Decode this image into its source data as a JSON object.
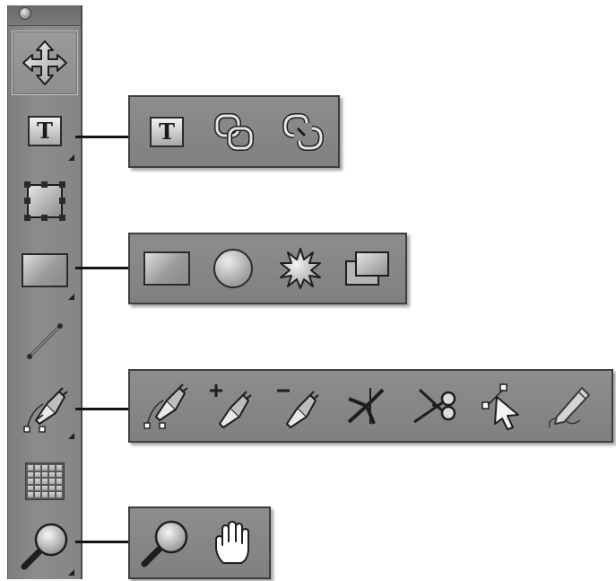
{
  "toolbar": {
    "tools": [
      {
        "name": "move-tool",
        "icon": "move-arrows-icon",
        "selected": true,
        "has_flyout": false
      },
      {
        "name": "text-tool",
        "icon": "text-icon",
        "label": "T",
        "selected": false,
        "has_flyout": true
      },
      {
        "name": "frame-tool",
        "icon": "frame-icon",
        "selected": false,
        "has_flyout": false
      },
      {
        "name": "rectangle-tool",
        "icon": "rectangle-icon",
        "selected": false,
        "has_flyout": true
      },
      {
        "name": "line-tool",
        "icon": "line-icon",
        "selected": false,
        "has_flyout": false
      },
      {
        "name": "pen-tool",
        "icon": "pen-icon",
        "selected": false,
        "has_flyout": true
      },
      {
        "name": "table-tool",
        "icon": "grid-icon",
        "selected": false,
        "has_flyout": false
      },
      {
        "name": "zoom-tool",
        "icon": "magnifier-icon",
        "selected": false,
        "has_flyout": true
      }
    ]
  },
  "flyouts": {
    "text": {
      "items": [
        {
          "name": "text-tool",
          "icon": "text-icon",
          "label": "T"
        },
        {
          "name": "link-text-tool",
          "icon": "link-icon"
        },
        {
          "name": "unlink-text-tool",
          "icon": "unlink-icon"
        }
      ]
    },
    "shapes": {
      "items": [
        {
          "name": "rectangle-tool",
          "icon": "rectangle-icon"
        },
        {
          "name": "ellipse-tool",
          "icon": "ellipse-icon"
        },
        {
          "name": "star-tool",
          "icon": "starburst-icon"
        },
        {
          "name": "shadow-rectangle-tool",
          "icon": "stacked-rectangles-icon"
        }
      ]
    },
    "pen": {
      "items": [
        {
          "name": "pen-tool",
          "icon": "pen-icon"
        },
        {
          "name": "add-anchor-tool",
          "icon": "pen-plus-icon",
          "sign": "+"
        },
        {
          "name": "delete-anchor-tool",
          "icon": "pen-minus-icon",
          "sign": "−"
        },
        {
          "name": "convert-anchor-tool",
          "icon": "convert-point-icon"
        },
        {
          "name": "scissors-tool",
          "icon": "scissors-icon"
        },
        {
          "name": "direct-select-tool",
          "icon": "direct-select-icon"
        },
        {
          "name": "pencil-tool",
          "icon": "pencil-icon"
        }
      ]
    },
    "zoom": {
      "items": [
        {
          "name": "zoom-tool",
          "icon": "magnifier-icon"
        },
        {
          "name": "hand-tool",
          "icon": "hand-icon"
        }
      ]
    }
  },
  "colors": {
    "panel": "#858585",
    "panel_border": "#3e3e3e",
    "connector": "#141414",
    "background": "#ffffff"
  }
}
